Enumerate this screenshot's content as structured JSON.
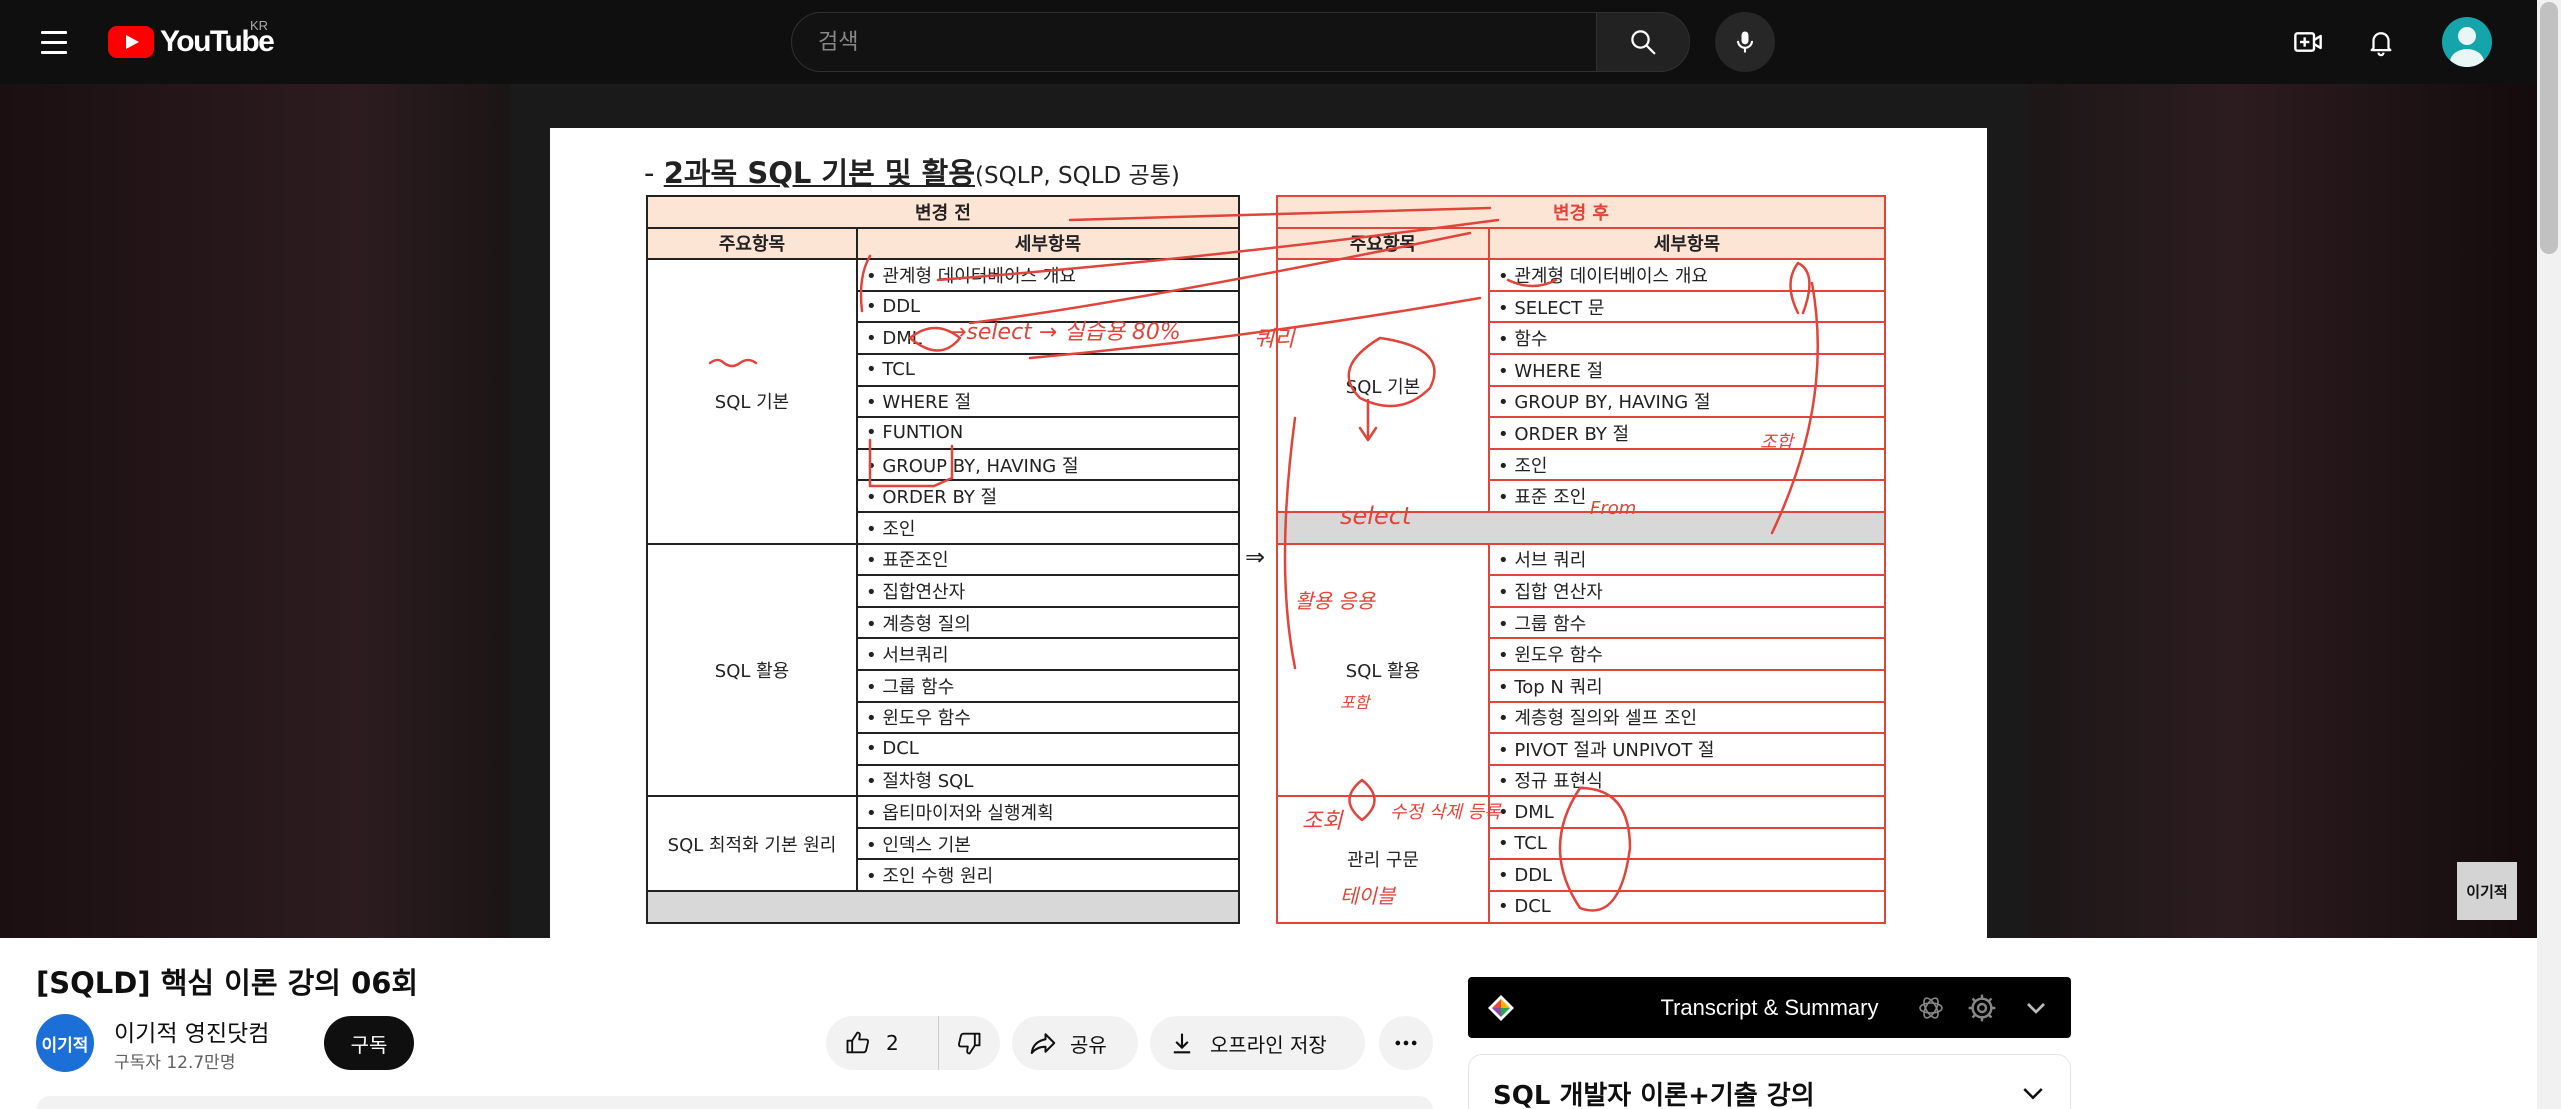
{
  "header": {
    "logo_text": "YouTube",
    "country_code": "KR",
    "search_placeholder": "검색",
    "avatar_color": "#14a4aa"
  },
  "icons": {
    "menu": "hamburger-menu-icon",
    "search": "search-icon",
    "mic": "microphone-icon",
    "create": "create-video-icon",
    "notifications": "bell-icon",
    "account": "user-avatar-icon",
    "like": "thumbs-up-icon",
    "dislike": "thumbs-down-icon",
    "share": "share-icon",
    "download": "download-icon",
    "more": "more-horizontal-icon",
    "openai": "openai-icon",
    "settings": "gear-icon",
    "chevron": "chevron-down-icon"
  },
  "slide": {
    "title_dash": "- ",
    "title_main": "2과목 SQL 기본 및 활용",
    "title_sub": "(SQLP, SQLD 공통)",
    "arrow": "⇒",
    "before": {
      "header": "변경 전",
      "col_main": "주요항목",
      "col_detail": "세부항목",
      "groups": [
        {
          "name": "SQL 기본",
          "items": [
            "• 관계형 데이터베이스 개요",
            "• DDL",
            "• DML",
            "• TCL",
            "• WHERE 절",
            "• FUNTION",
            "• GROUP BY, HAVING 절",
            "• ORDER BY 절",
            "• 조인"
          ]
        },
        {
          "name": "SQL 활용",
          "items": [
            "• 표준조인",
            "• 집합연산자",
            "• 계층형 질의",
            "• 서브쿼리",
            "• 그룹 함수",
            "• 윈도우 함수",
            "• DCL",
            "• 절차형 SQL"
          ]
        },
        {
          "name": "SQL 최적화 기본 원리",
          "items": [
            "• 옵티마이저와 실행계획",
            "• 인덱스 기본",
            "• 조인 수행 원리"
          ]
        }
      ]
    },
    "after": {
      "header": "변경 후",
      "col_main": "주요항목",
      "col_detail": "세부항목",
      "groups": [
        {
          "name": "SQL 기본",
          "items": [
            "• 관계형 데이터베이스 개요",
            "• SELECT 문",
            "• 함수",
            "• WHERE 절",
            "• GROUP BY, HAVING 절",
            "• ORDER BY 절",
            "• 조인",
            "• 표준 조인"
          ]
        },
        {
          "name": "SQL 활용",
          "items": [
            "• 서브 쿼리",
            "• 집합 연산자",
            "• 그룹 함수",
            "• 윈도우 함수",
            "• Top N 쿼리",
            "• 계층형 질의와 셀프 조인",
            "• PIVOT 절과 UNPIVOT 절",
            "• 정규 표현식"
          ]
        },
        {
          "name": "관리 구문",
          "items": [
            "• DML",
            "• TCL",
            "• DDL",
            "• DCL"
          ]
        }
      ]
    },
    "annotations": {
      "color": "#e0443a",
      "dml_note": "→select → 실습용 80%",
      "query_label": "쿼리",
      "select_circle": "select",
      "usage_note": "활용 응용",
      "from_note": "From",
      "join_note": "조합",
      "aux_note": "포함",
      "query_note": "조회",
      "modify_note": "수정 삭제 등록",
      "table_note": "테이블"
    },
    "watermark": "이기적"
  },
  "video": {
    "title": "[SQLD] 핵심 이론 강의 06회",
    "channel_avatar_text": "이기적",
    "channel_name": "이기적 영진닷컴",
    "subscribers": "구독자 12.7만명",
    "subscribe_label": "구독",
    "like_count": "2",
    "share_label": "공유",
    "offline_label": "오프라인 저장"
  },
  "side_panel": {
    "transcript_title": "Transcript & Summary",
    "playlist_title": "SQL 개발자 이론+기출 강의"
  }
}
